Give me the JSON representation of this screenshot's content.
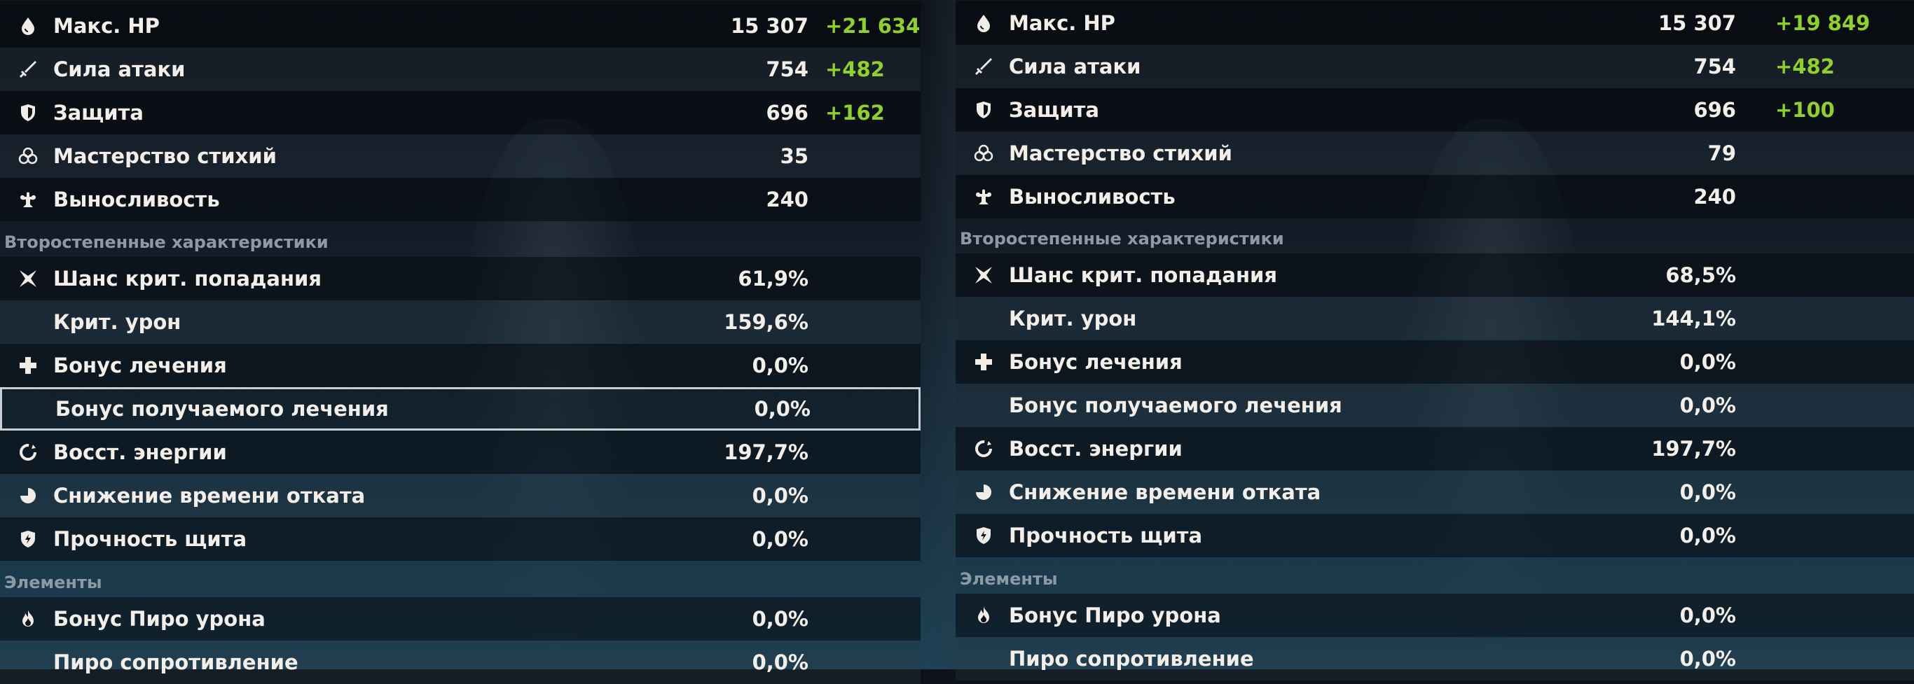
{
  "panels": [
    {
      "sections": {
        "secondary": "Второстепенные характеристики",
        "elements": "Элементы"
      },
      "main": [
        {
          "icon": "hp-drop-icon",
          "label": "Макс. HP",
          "value": "15 307",
          "bonus": "+21 634"
        },
        {
          "icon": "sword-icon",
          "label": "Сила атаки",
          "value": "754",
          "bonus": "+482"
        },
        {
          "icon": "shield-icon",
          "label": "Защита",
          "value": "696",
          "bonus": "+162"
        },
        {
          "icon": "elemental-mastery-icon",
          "label": "Мастерство стихий",
          "value": "35",
          "bonus": ""
        },
        {
          "icon": "stamina-icon",
          "label": "Выносливость",
          "value": "240",
          "bonus": ""
        }
      ],
      "secondary": [
        {
          "icon": "crit-star-icon",
          "label": "Шанс крит. попадания",
          "value": "61,9%"
        },
        {
          "icon": "",
          "label": "Крит. урон",
          "value": "159,6%"
        },
        {
          "icon": "healing-cross-icon",
          "label": "Бонус лечения",
          "value": "0,0%"
        },
        {
          "icon": "",
          "label": "Бонус получаемого лечения",
          "value": "0,0%"
        },
        {
          "icon": "energy-recharge-icon",
          "label": "Восст. энергии",
          "value": "197,7%"
        },
        {
          "icon": "cooldown-icon",
          "label": "Снижение времени отката",
          "value": "0,0%"
        },
        {
          "icon": "shield-strength-icon",
          "label": "Прочность щита",
          "value": "0,0%"
        }
      ],
      "elements": [
        {
          "icon": "pyro-icon",
          "label": "Бонус Пиро урона",
          "value": "0,0%"
        },
        {
          "icon": "",
          "label": "Пиро сопротивление",
          "value": "0,0%"
        }
      ]
    },
    {
      "sections": {
        "secondary": "Второстепенные характеристики",
        "elements": "Элементы"
      },
      "main": [
        {
          "icon": "hp-drop-icon",
          "label": "Макс. HP",
          "value": "15 307",
          "bonus": "+19 849"
        },
        {
          "icon": "sword-icon",
          "label": "Сила атаки",
          "value": "754",
          "bonus": "+482"
        },
        {
          "icon": "shield-icon",
          "label": "Защита",
          "value": "696",
          "bonus": "+100"
        },
        {
          "icon": "elemental-mastery-icon",
          "label": "Мастерство стихий",
          "value": "79",
          "bonus": ""
        },
        {
          "icon": "stamina-icon",
          "label": "Выносливость",
          "value": "240",
          "bonus": ""
        }
      ],
      "secondary": [
        {
          "icon": "crit-star-icon",
          "label": "Шанс крит. попадания",
          "value": "68,5%"
        },
        {
          "icon": "",
          "label": "Крит. урон",
          "value": "144,1%"
        },
        {
          "icon": "healing-cross-icon",
          "label": "Бонус лечения",
          "value": "0,0%"
        },
        {
          "icon": "",
          "label": "Бонус получаемого лечения",
          "value": "0,0%"
        },
        {
          "icon": "energy-recharge-icon",
          "label": "Восст. энергии",
          "value": "197,7%"
        },
        {
          "icon": "cooldown-icon",
          "label": "Снижение времени отката",
          "value": "0,0%"
        },
        {
          "icon": "shield-strength-icon",
          "label": "Прочность щита",
          "value": "0,0%"
        }
      ],
      "elements": [
        {
          "icon": "pyro-icon",
          "label": "Бонус Пиро урона",
          "value": "0,0%"
        },
        {
          "icon": "",
          "label": "Пиро сопротивление",
          "value": "0,0%"
        }
      ]
    }
  ],
  "colors": {
    "bonus": "#8fd12a",
    "text": "#f3efe8",
    "section": "#8d9aa6",
    "selected_border": "#c9ced3"
  }
}
